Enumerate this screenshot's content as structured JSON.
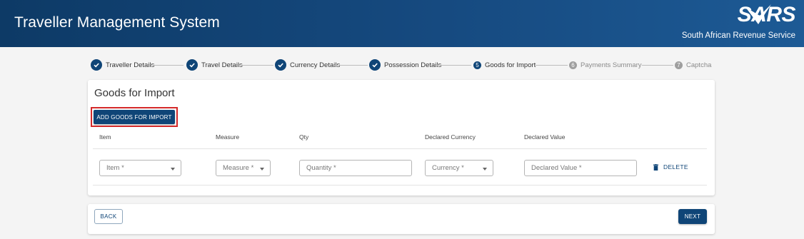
{
  "header": {
    "title": "Traveller Management System",
    "logo_text": "SARS",
    "tagline": "South African Revenue Service"
  },
  "stepper": {
    "steps": [
      {
        "label": "Traveller Details",
        "state": "done"
      },
      {
        "label": "Travel Details",
        "state": "done"
      },
      {
        "label": "Currency Details",
        "state": "done"
      },
      {
        "label": "Possession Details",
        "state": "done"
      },
      {
        "label": "Goods for Import",
        "state": "active",
        "number": "5"
      },
      {
        "label": "Payments Summary",
        "state": "todo",
        "number": "6"
      },
      {
        "label": "Captcha",
        "state": "todo",
        "number": "7"
      }
    ]
  },
  "goods": {
    "title": "Goods for Import",
    "add_button": "ADD GOODS FOR IMPORT",
    "columns": [
      "Item",
      "Measure",
      "Qty",
      "Declared Currency",
      "Declared Value"
    ],
    "row": {
      "item_placeholder": "Item *",
      "measure_placeholder": "Measure *",
      "quantity_placeholder": "Quantity *",
      "currency_placeholder": "Currency *",
      "value_placeholder": "Declared Value *",
      "delete_label": "DELETE"
    }
  },
  "footer": {
    "back_label": "BACK",
    "next_label": "NEXT"
  },
  "colors": {
    "primary": "#0f4577",
    "header_gradient_start": "#0d3a66",
    "highlight_border": "#d42a2a"
  }
}
